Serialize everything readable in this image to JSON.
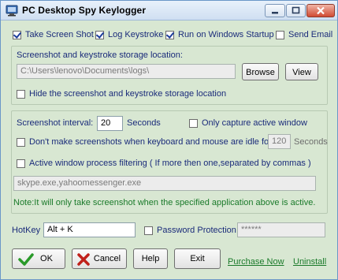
{
  "window": {
    "title": "PC Desktop Spy Keylogger"
  },
  "titlebar": {
    "minimize_icon": "minimize-icon",
    "maximize_icon": "maximize-icon",
    "close_icon": "close-icon"
  },
  "options": {
    "take_screenshot": {
      "label": "Take Screen Shot",
      "checked": true
    },
    "log_keystroke": {
      "label": "Log Keystroke",
      "checked": true
    },
    "run_on_startup": {
      "label": "Run on Windows Startup",
      "checked": true
    },
    "send_email": {
      "label": "Send Email",
      "checked": false
    }
  },
  "storage": {
    "heading": "Screenshot and keystroke storage location:",
    "path": "C:\\Users\\lenovo\\Documents\\logs\\",
    "browse_label": "Browse",
    "view_label": "View",
    "hide_label": "Hide the screenshot and keystroke storage location",
    "hide_checked": false
  },
  "screenshot": {
    "interval_label": "Screenshot interval:",
    "interval_value": "20",
    "interval_unit": "Seconds",
    "active_only_label": "Only capture active window",
    "active_only_checked": false,
    "idle_label": "Don't make screenshots when keyboard and mouse are idle for",
    "idle_checked": false,
    "idle_value": "120",
    "idle_unit": "Seconds",
    "filter_label": "Active window process filtering ( If more then one,separated by commas )",
    "filter_checked": false,
    "filter_value": "skype.exe,yahoomessenger.exe",
    "note": "Note:It will only take screenshot when the specified application above is active."
  },
  "hotkey": {
    "label": "HotKey",
    "value": "Alt + K"
  },
  "password": {
    "label": "Password Protection",
    "checked": false,
    "value": "******"
  },
  "buttons": {
    "ok_label": "OK",
    "cancel_label": "Cancel",
    "help_label": "Help",
    "exit_label": "Exit",
    "purchase_label": "Purchase Now",
    "uninstall_label": "Uninstall"
  },
  "colors": {
    "label_text": "#1a2b7a",
    "background": "#d8e7d2",
    "link": "#1a7a2a",
    "ok_check": "#2a9a2a",
    "cancel_x": "#c0201a"
  }
}
